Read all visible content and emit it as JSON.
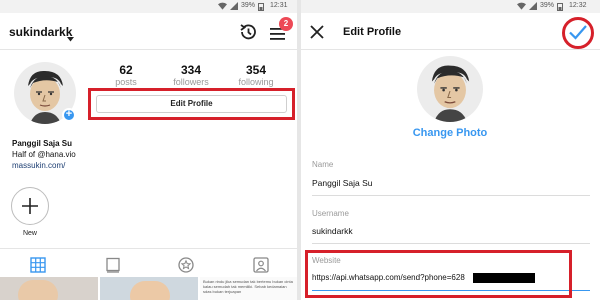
{
  "left": {
    "status": {
      "battery": "39%",
      "time": "12:31"
    },
    "header": {
      "username": "sukindarkk",
      "notification_count": "2"
    },
    "stats": [
      {
        "value": "62",
        "label": "posts"
      },
      {
        "value": "334",
        "label": "followers"
      },
      {
        "value": "354",
        "label": "following"
      }
    ],
    "edit_profile_label": "Edit Profile",
    "bio": {
      "name": "Panggil Saja Su",
      "line": "Half of @hana.vio",
      "link": "massukin.com/"
    },
    "new_highlight_label": "New",
    "post_text": "Bukan rindu jika semudan tak bertemu bukan cinta kalau semudah tak memiliki. Sebab kedamaian sdas bukan terjuapan"
  },
  "right": {
    "status": {
      "battery": "39%",
      "time": "12:32"
    },
    "title": "Edit Profile",
    "change_photo": "Change Photo",
    "fields": [
      {
        "label": "Name",
        "value": "Panggil Saja Su"
      },
      {
        "label": "Username",
        "value": "sukindarkk"
      },
      {
        "label": "Website",
        "value": "https://api.whatsapp.com/send?phone=628"
      }
    ]
  },
  "colors": {
    "annotation_red": "#d6202a",
    "accent_blue": "#3897f0",
    "badge_red": "#ed4956"
  }
}
